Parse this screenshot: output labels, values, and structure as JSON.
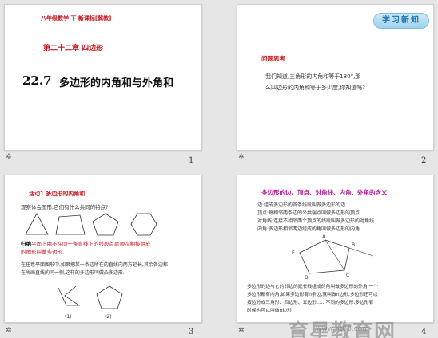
{
  "slides": [
    {
      "number": "1",
      "subject_line": "八年级数学 下  新课标[冀教]",
      "chapter": "第二十二章   四边形",
      "section_num": "22.7",
      "section_title": "多边形的内角和与外角和"
    },
    {
      "number": "2",
      "badge": "学习新知",
      "heading": "问题思考",
      "line1": "我们知道,三角形的内角和等于180°,那",
      "line2": "么四边形的内角和等于多少度,你知道吗?"
    },
    {
      "number": "3",
      "activity": "活动1   多边形的内角和",
      "observe": "观察体会图形,它们有什么共同的特点?",
      "note_label": "归纳",
      "note_text": "平面上由不在同一条直线上的线段首尾顺次相接组成",
      "note_text2": "的图形叫做多边形.",
      "body1": "在任意平面图形中,如果把某一条边所在的直线向两方延长,其余各边都",
      "body2": "在所画直线的同一侧,这样的多边形叫做凸多边形.",
      "fig_a": "(1)",
      "fig_b": "(2)"
    },
    {
      "number": "4",
      "heading": "多边形的边、顶点、对角线、内角、外角的含义",
      "items": [
        "边:组成多边形的各条线段叫做多边形的边.",
        "顶点:每相邻两条边的公共端点叫做多边形的顶点.",
        "对角线:连接不相邻两个顶点的线段叫做多边形的对角线.",
        "内角:多边形相邻两边组成的角叫做多边形的内角."
      ],
      "labels": [
        "A",
        "B",
        "C",
        "D",
        "E"
      ],
      "para1": "多边形的边与它的邻边的延长线组成的角叫做多边形的外角.一个",
      "para2": "多边形都有内角,如果多边形有n条边,就叫做n边形,多边形还可以",
      "para3": "按边分成三角形、四边形、五边形……不同的多边形.多边形有",
      "para4": "时候也可以叫做n边形"
    }
  ],
  "watermark": {
    "text": "育星教育网",
    "url": "www.ht88.com"
  }
}
